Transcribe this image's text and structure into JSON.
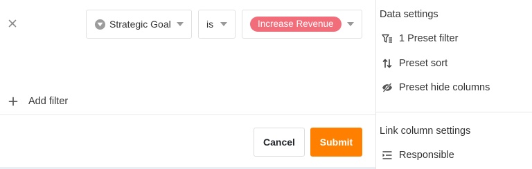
{
  "filter": {
    "column": "Strategic Goal",
    "operator": "is",
    "value": "Increase Revenue",
    "value_color": "#f16d7a"
  },
  "add_filter_label": "Add filter",
  "buttons": {
    "cancel": "Cancel",
    "submit": "Submit",
    "submit_color": "#ff8000"
  },
  "panel": {
    "data_settings_title": "Data settings",
    "items": [
      {
        "icon": "filter-icon",
        "label": "1 Preset filter"
      },
      {
        "icon": "sort-icon",
        "label": "Preset sort"
      },
      {
        "icon": "eye-slash-icon",
        "label": "Preset hide columns"
      }
    ],
    "link_settings_title": "Link column settings",
    "link_items": [
      {
        "icon": "link-column-icon",
        "label": "Responsible"
      }
    ]
  }
}
